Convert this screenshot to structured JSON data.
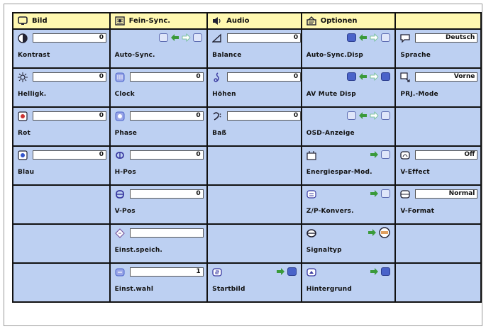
{
  "headers": [
    {
      "label": "Bild",
      "icon": "monitor-icon"
    },
    {
      "label": "Fein-Sync.",
      "icon": "fine-sync-icon"
    },
    {
      "label": "Audio",
      "icon": "speaker-icon"
    },
    {
      "label": "Optionen",
      "icon": "options-icon"
    },
    {
      "label": "",
      "icon": ""
    }
  ],
  "bild": {
    "kontrast": {
      "label": "Kontrast",
      "value": "0"
    },
    "helligk": {
      "label": "Helligk.",
      "value": "0"
    },
    "rot": {
      "label": "Rot",
      "value": "0"
    },
    "blau": {
      "label": "Blau",
      "value": "0"
    }
  },
  "fein": {
    "auto_sync": {
      "label": "Auto-Sync."
    },
    "clock": {
      "label": "Clock",
      "value": "0"
    },
    "phase": {
      "label": "Phase",
      "value": "0"
    },
    "h_pos": {
      "label": "H-Pos",
      "value": "0"
    },
    "v_pos": {
      "label": "V-Pos",
      "value": "0"
    },
    "einst_speich": {
      "label": "Einst.speich.",
      "value": ""
    },
    "einst_wahl": {
      "label": "Einst.wahl",
      "value": "1"
    }
  },
  "audio": {
    "balance": {
      "label": "Balance",
      "value": "0"
    },
    "hoehen": {
      "label": "Höhen",
      "value": "0"
    },
    "bass": {
      "label": "Baß",
      "value": "0"
    },
    "startbild": {
      "label": "Startbild"
    }
  },
  "optionen": {
    "auto_sync_disp": {
      "label": "Auto-Sync.Disp"
    },
    "av_mute_disp": {
      "label": "AV Mute Disp"
    },
    "osd_anzeige": {
      "label": "OSD-Anzeige"
    },
    "energiespar": {
      "label": "Energiespar-Mod."
    },
    "z_p_konvers": {
      "label": "Z/P-Konvers."
    },
    "signaltyp": {
      "label": "Signaltyp"
    },
    "hintergrund": {
      "label": "Hintergrund"
    }
  },
  "col5": {
    "sprache": {
      "label": "Sprache",
      "value": "Deutsch"
    },
    "prj_mode": {
      "label": "PRJ.-Mode",
      "value": "Vorne"
    },
    "v_effect": {
      "label": "V-Effect",
      "value": "Off"
    },
    "v_format": {
      "label": "V-Format",
      "value": "Normal"
    }
  },
  "colors": {
    "header_bg": "#fff8b0",
    "cell_bg": "#bdd0f2",
    "accent_blue": "#4a63c9",
    "arrow_green": "#3a9a3a"
  }
}
